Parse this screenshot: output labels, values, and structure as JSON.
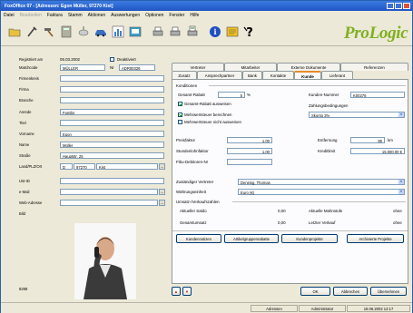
{
  "window": {
    "title": "FoxOffice 07 - [Adressen: Egon Müller, 97270 Kist]"
  },
  "menu": [
    {
      "label": "Datei",
      "disabled": false
    },
    {
      "label": "Bearbeiten",
      "disabled": true
    },
    {
      "label": "Faktura",
      "disabled": false
    },
    {
      "label": "Stamm",
      "disabled": false
    },
    {
      "label": "Aktionen",
      "disabled": false
    },
    {
      "label": "Auswertungen",
      "disabled": false
    },
    {
      "label": "Optionen",
      "disabled": false
    },
    {
      "label": "Fenster",
      "disabled": false
    },
    {
      "label": "Hilfe",
      "disabled": false
    }
  ],
  "toolbar": {
    "icons": [
      "folder-icon",
      "tools-icon",
      "hammer-icon",
      "calculator-icon",
      "satellite-icon",
      "car-icon",
      "chart-icon",
      "contacts-icon",
      "printer-icon",
      "printer2-icon",
      "document-print-icon",
      "info-icon",
      "notes-icon",
      "help-icon"
    ],
    "logo": "ProLogic"
  },
  "left": {
    "registered_label": "Registriert am",
    "registered_value": "05.03.2002",
    "deactivated_label": "Deaktiviert",
    "matchcode_label": "Matchcode",
    "matchcode_value": "MÜLLER",
    "nr_label": "Nr",
    "nr_value": "ADR00326",
    "firmenkreis_label": "Firmenkreis",
    "firma_label": "Firma",
    "branche_label": "Branche",
    "anrede_label": "Anrede",
    "anrede_value": "Familie",
    "titel_label": "Titel",
    "vorname_label": "Vorname",
    "vorname_value": "Egon",
    "name_label": "Name",
    "name_value": "Müller",
    "strasse_label": "Straße",
    "strasse_value": "Hauptstr. 25",
    "ort_label": "Land/PLZ/Ort",
    "land_value": "D",
    "plz_value": "97270",
    "ort_value": "Kist",
    "ustid_label": "Ust-ID",
    "email_label": "e-Mail",
    "web_label": "Web-Adresse",
    "bild_label": "Bild",
    "record_no": "8288"
  },
  "tabs_top": [
    "Vertreter",
    "Mitarbeiter",
    "Externe Dokumente",
    "Referenzen"
  ],
  "tabs_bottom": [
    "Zusatz",
    "Ansprechpartner",
    "Bank",
    "Kontakte",
    "Kunde",
    "Lieferant"
  ],
  "active_tab": "Kunde",
  "panel": {
    "konditionen_title": "Konditionen",
    "gesamt_rabatt_label": "Gesamt-Rabatt",
    "gesamt_rabatt_value": "5",
    "gesamt_rabatt_unit": "%",
    "gesamt_rabatt_ausweisen": "Gesamt-Rabatt ausweisen",
    "mwst_berechnen": "Mehrwertsteuer berechnen",
    "mwst_nicht_ausweisen": "Mehrwertsteuer nicht ausweisen",
    "kundennummer_label": "Kunden-Nummer",
    "kundennummer_value": "K00276",
    "zahlungsbedingungen_label": "Zahlungsbedingungen",
    "zahlungsbedingungen_value": "Skonto 2%",
    "preisfaktor_label": "Preisfaktor",
    "preisfaktor_value": "1,00",
    "stundenfaktor_label": "Stundenlohnfaktor",
    "stundenfaktor_value": "1,00",
    "fibu_label": "Fibu-Debitoren-Nr",
    "entfernung_label": "Entfernung",
    "entfernung_value": "85",
    "entfernung_unit": "km",
    "kreditlimit_label": "Kreditlimit",
    "kreditlimit_value": "15.000,00 €",
    "vertreter_label": "Zuständiger Vertreter",
    "vertreter_value": "Densing, Thomas",
    "waehrung_label": "Währungseinheit",
    "waehrung_value": "Euro (€)",
    "umsatz_title": "Umsatz-/Verkaufszahlen",
    "saldo_label": "Aktueller Saldo",
    "saldo_value": "0,00",
    "mahnstufe_label": "Aktuelle Mahnstufe",
    "mahnstufe_value": "ohne",
    "gesamtumsatz_label": "Gesamtumsatz",
    "gesamtumsatz_value": "0,00",
    "letzter_verkauf_label": "Letzter Verkauf",
    "letzter_verkauf_value": "ohne"
  },
  "buttons": {
    "kundennotizen": "Kundennotizen",
    "artikelgruppenrabatte": "Artikelgruppenrabatte",
    "kundenprojekte": "Kundenprojekte",
    "archivierte_projekte": "Archivierte Projekte",
    "ok": "OK",
    "abbrechen": "Abbrechen",
    "uebernehmen": "Übernehmen"
  },
  "status": {
    "module": "Adressen",
    "user": "Administrator",
    "datetime": "19.06.2002 12:17"
  }
}
